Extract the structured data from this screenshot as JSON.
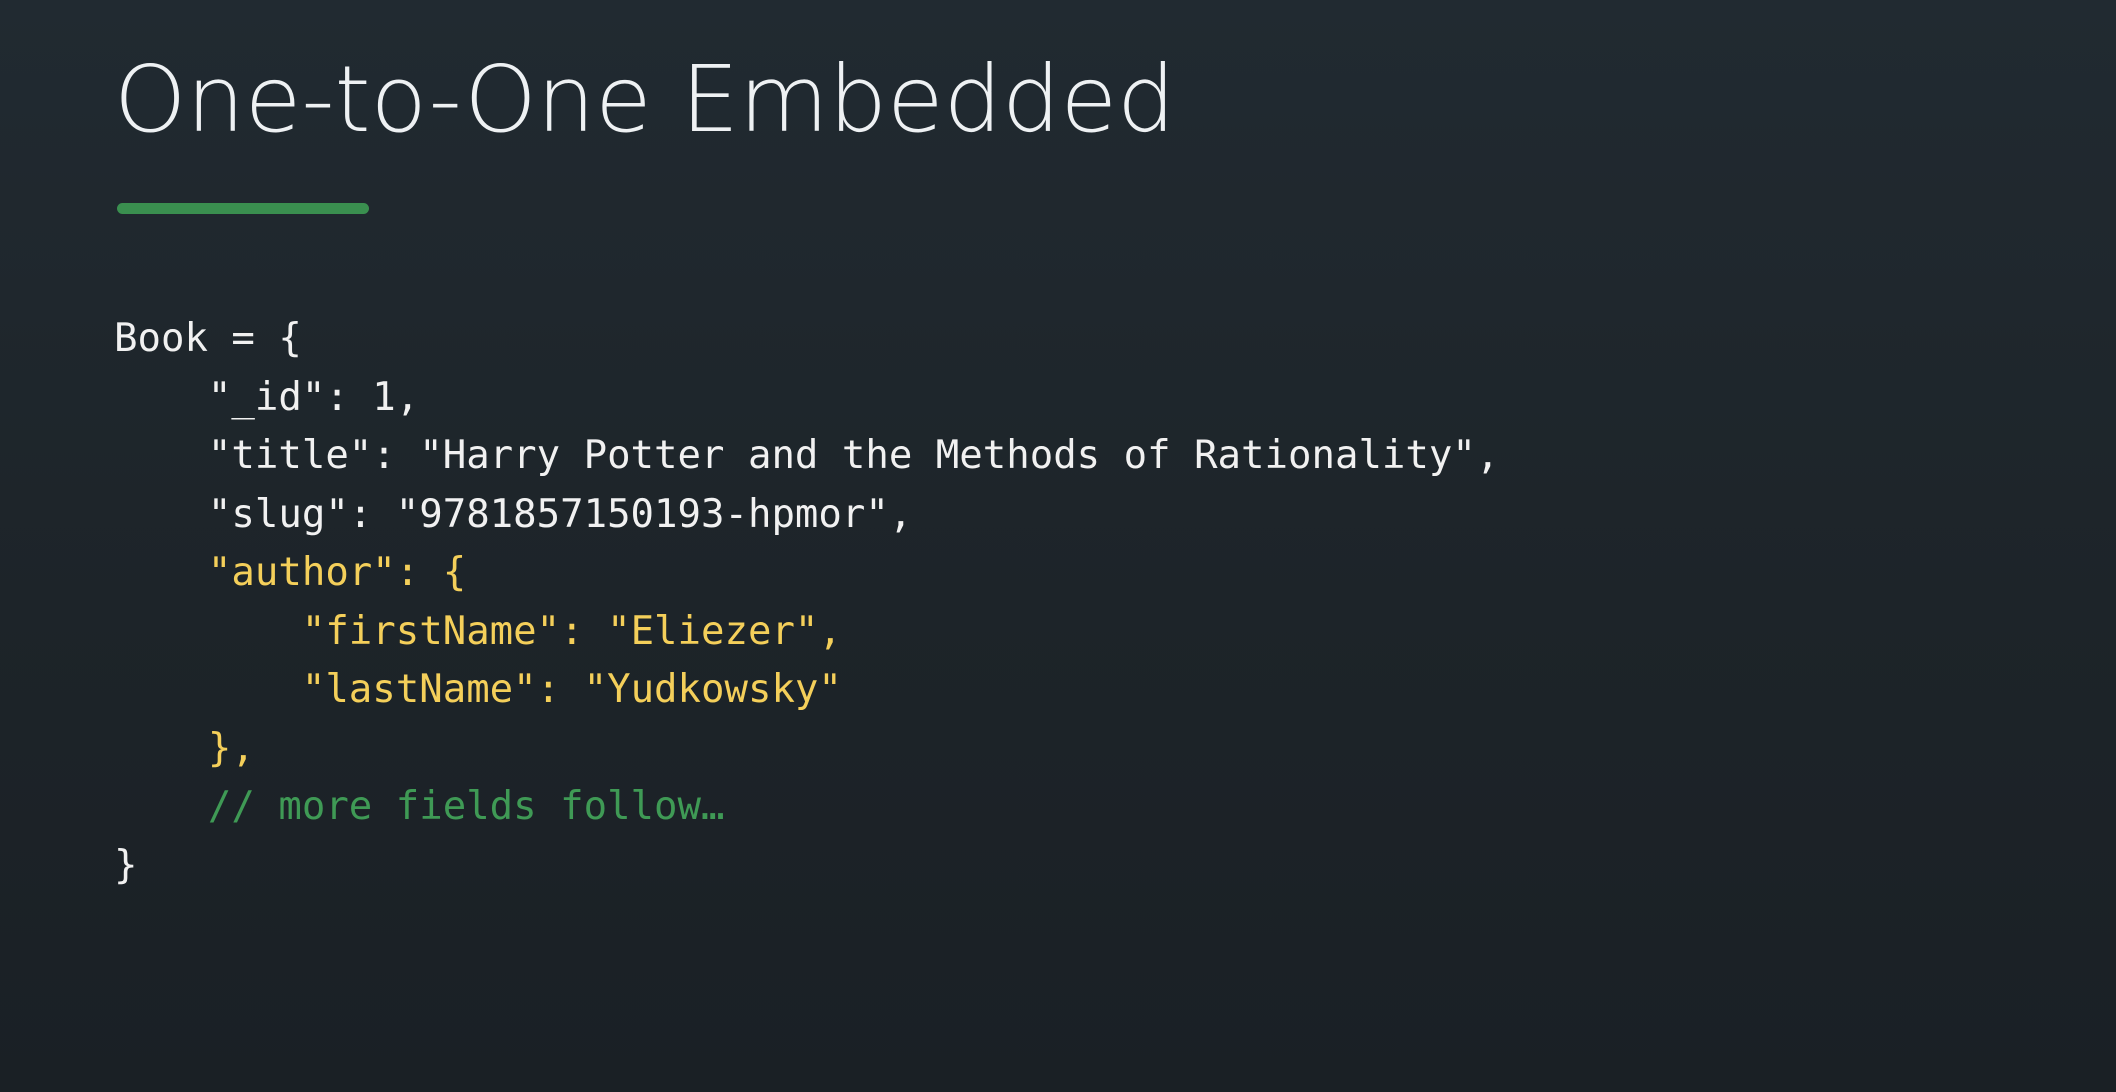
{
  "slide": {
    "title": "One-to-One Embedded"
  },
  "code": {
    "lines": [
      {
        "indent": "",
        "text": "Book = {",
        "style": "plain"
      },
      {
        "indent": "    ",
        "text": "\"_id\": 1,",
        "style": "plain"
      },
      {
        "indent": "    ",
        "text": "\"title\": \"Harry Potter and the Methods of Rationality\",",
        "style": "plain"
      },
      {
        "indent": "    ",
        "text": "\"slug\": \"9781857150193-hpmor\",",
        "style": "plain"
      },
      {
        "indent": "    ",
        "text": "\"author\": {",
        "style": "accent"
      },
      {
        "indent": "        ",
        "text": "\"firstName\": \"Eliezer\",",
        "style": "accent"
      },
      {
        "indent": "        ",
        "text": "\"lastName\": \"Yudkowsky\"",
        "style": "accent"
      },
      {
        "indent": "    ",
        "text": "},",
        "style": "accent"
      },
      {
        "indent": "    ",
        "text": "// more fields follow…",
        "style": "comment"
      },
      {
        "indent": "",
        "text": "}",
        "style": "plain"
      }
    ]
  },
  "colors": {
    "background": "#1f272d",
    "title_text": "#eef1f3",
    "underline_accent": "#3a8f4f",
    "code_plain": "#f1f1f1",
    "code_highlight": "#f4cf5a",
    "code_comment": "#3f9a55"
  }
}
